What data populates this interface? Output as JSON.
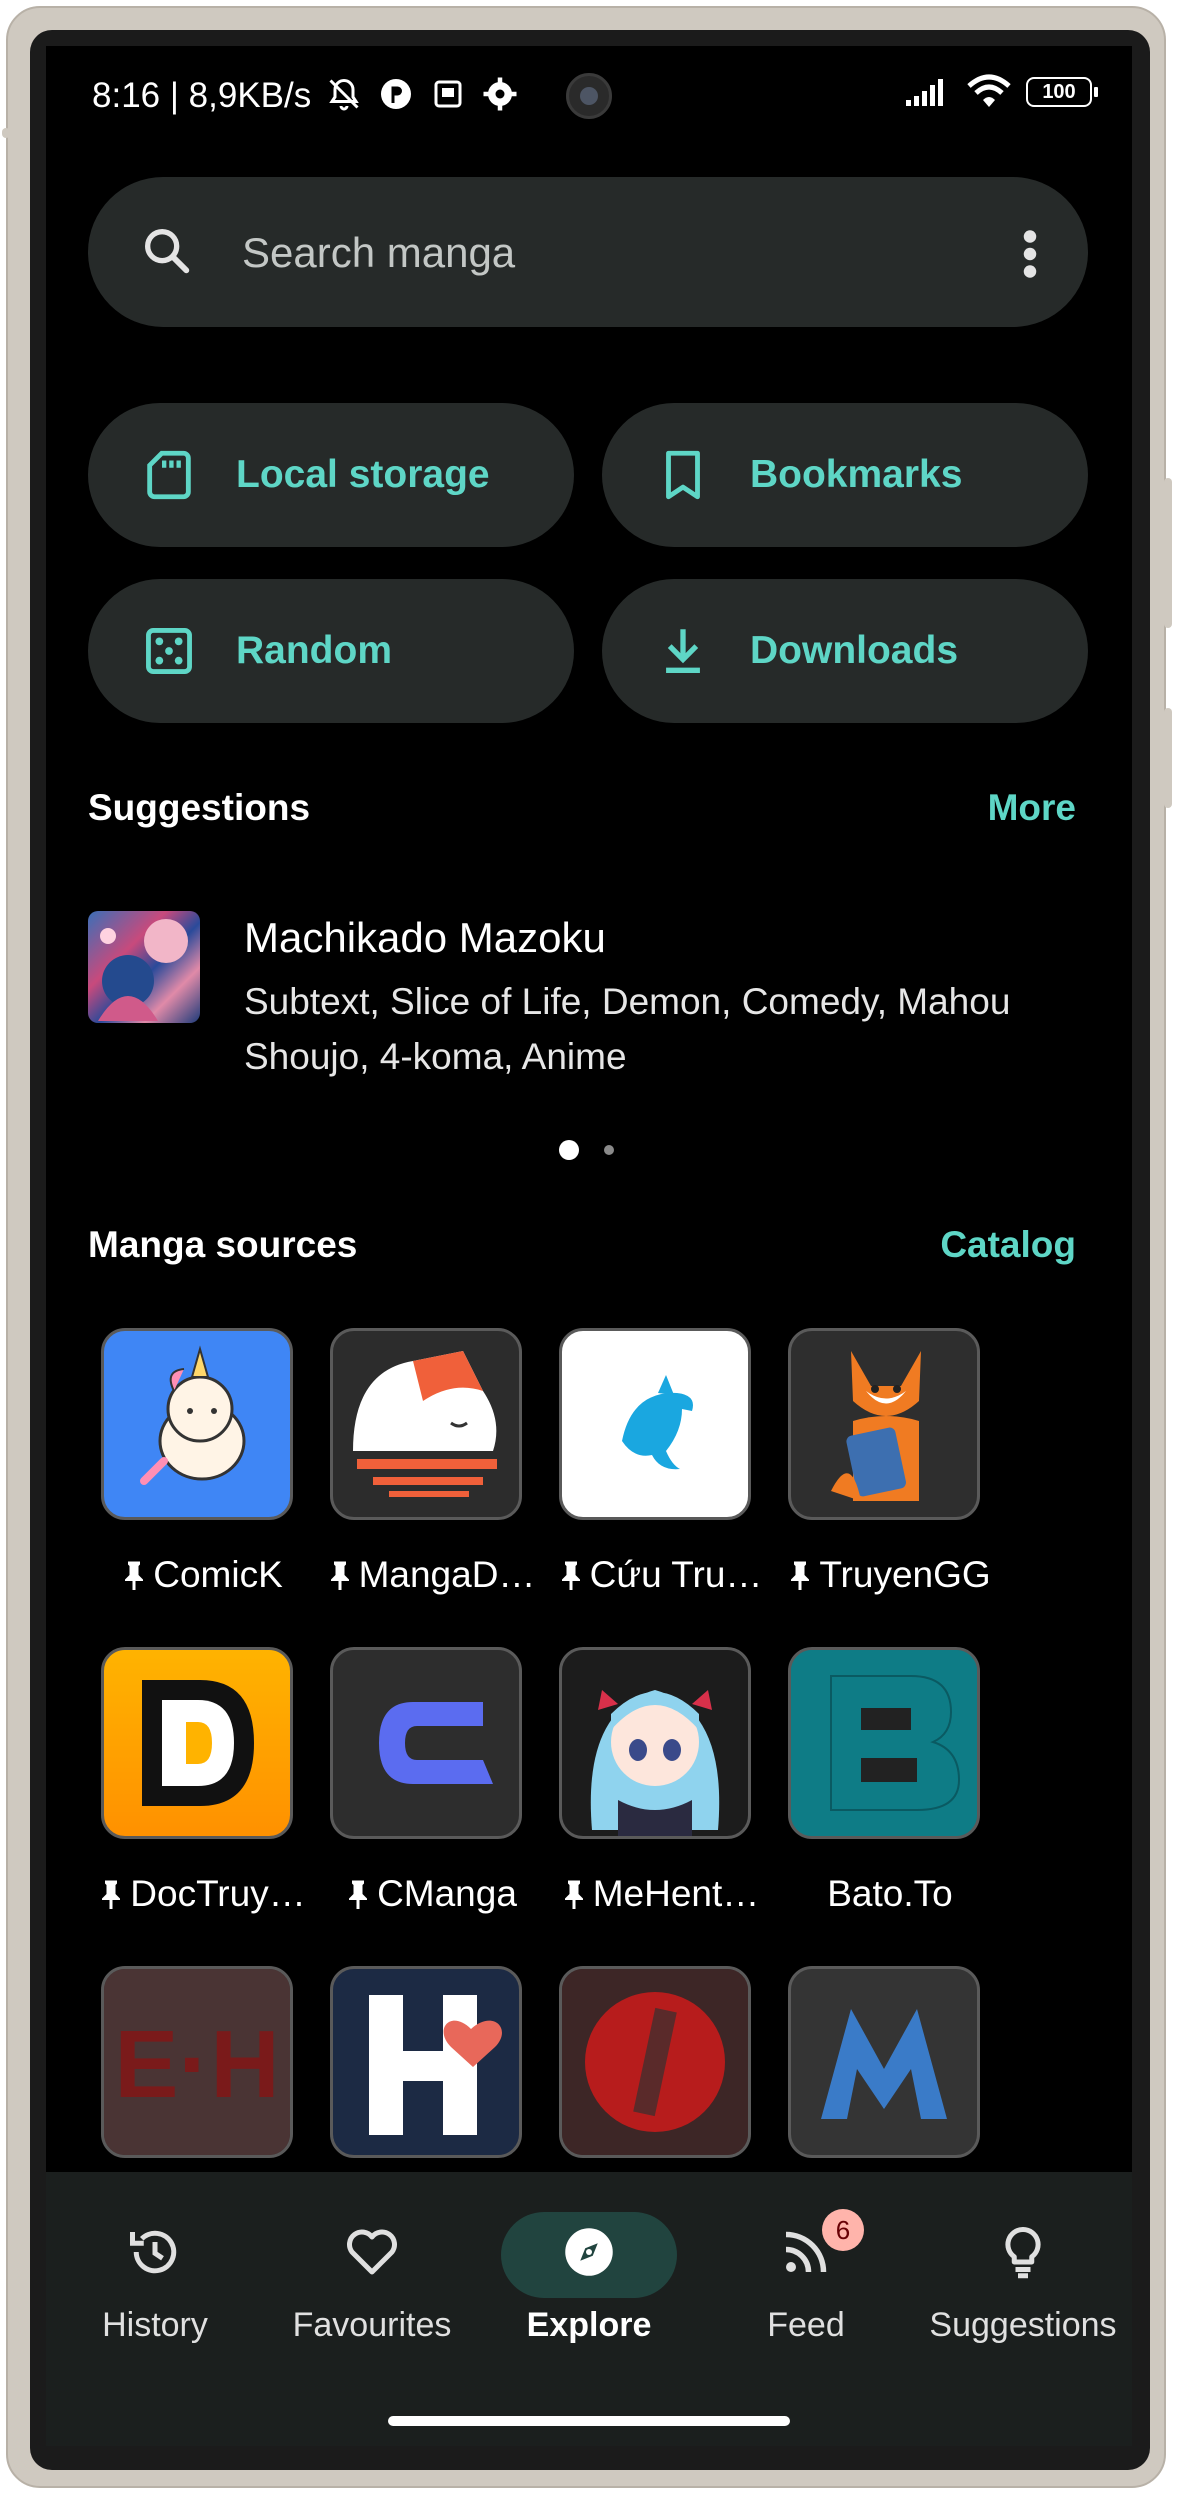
{
  "status_bar": {
    "time": "8:16 | 8,9KB/s",
    "battery": "100"
  },
  "search": {
    "placeholder": "Search manga"
  },
  "quick_actions": [
    {
      "label": "Local storage",
      "icon": "sd-card-icon"
    },
    {
      "label": "Bookmarks",
      "icon": "bookmark-icon"
    },
    {
      "label": "Random",
      "icon": "dice-icon"
    },
    {
      "label": "Downloads",
      "icon": "download-icon"
    }
  ],
  "suggestions": {
    "title": "Suggestions",
    "link": "More",
    "item": {
      "title": "Machikado Mazoku",
      "tags": "Subtext, Slice of  Life, Demon, Comedy, Mahou Shoujo, 4-koma, Anime"
    },
    "page_count": 2,
    "current_page": 1
  },
  "manga_sources": {
    "title": "Manga sources",
    "link": "Catalog",
    "items": [
      {
        "name": "ComicK",
        "pinned": true
      },
      {
        "name": "MangaD…",
        "pinned": true
      },
      {
        "name": "Cứu Tru…",
        "pinned": true
      },
      {
        "name": "TruyenGG",
        "pinned": true
      },
      {
        "name": "DocTruy…",
        "pinned": true
      },
      {
        "name": "CManga",
        "pinned": true
      },
      {
        "name": "MeHent…",
        "pinned": true
      },
      {
        "name": "Bato.To",
        "pinned": false
      },
      {
        "name": "",
        "pinned": false
      },
      {
        "name": "",
        "pinned": false
      },
      {
        "name": "",
        "pinned": false
      },
      {
        "name": "",
        "pinned": false
      }
    ]
  },
  "bottom_nav": {
    "items": [
      {
        "label": "History",
        "icon": "history-icon"
      },
      {
        "label": "Favourites",
        "icon": "heart-icon"
      },
      {
        "label": "Explore",
        "icon": "compass-icon",
        "active": true
      },
      {
        "label": "Feed",
        "icon": "rss-icon",
        "badge": "6"
      },
      {
        "label": "Suggestions",
        "icon": "lightbulb-icon"
      }
    ]
  },
  "colors": {
    "accent": "#5ed6c6",
    "surface": "#262a29",
    "background": "#000000",
    "nav_active_pill": "#21443f",
    "badge": "#ffb4ab"
  }
}
